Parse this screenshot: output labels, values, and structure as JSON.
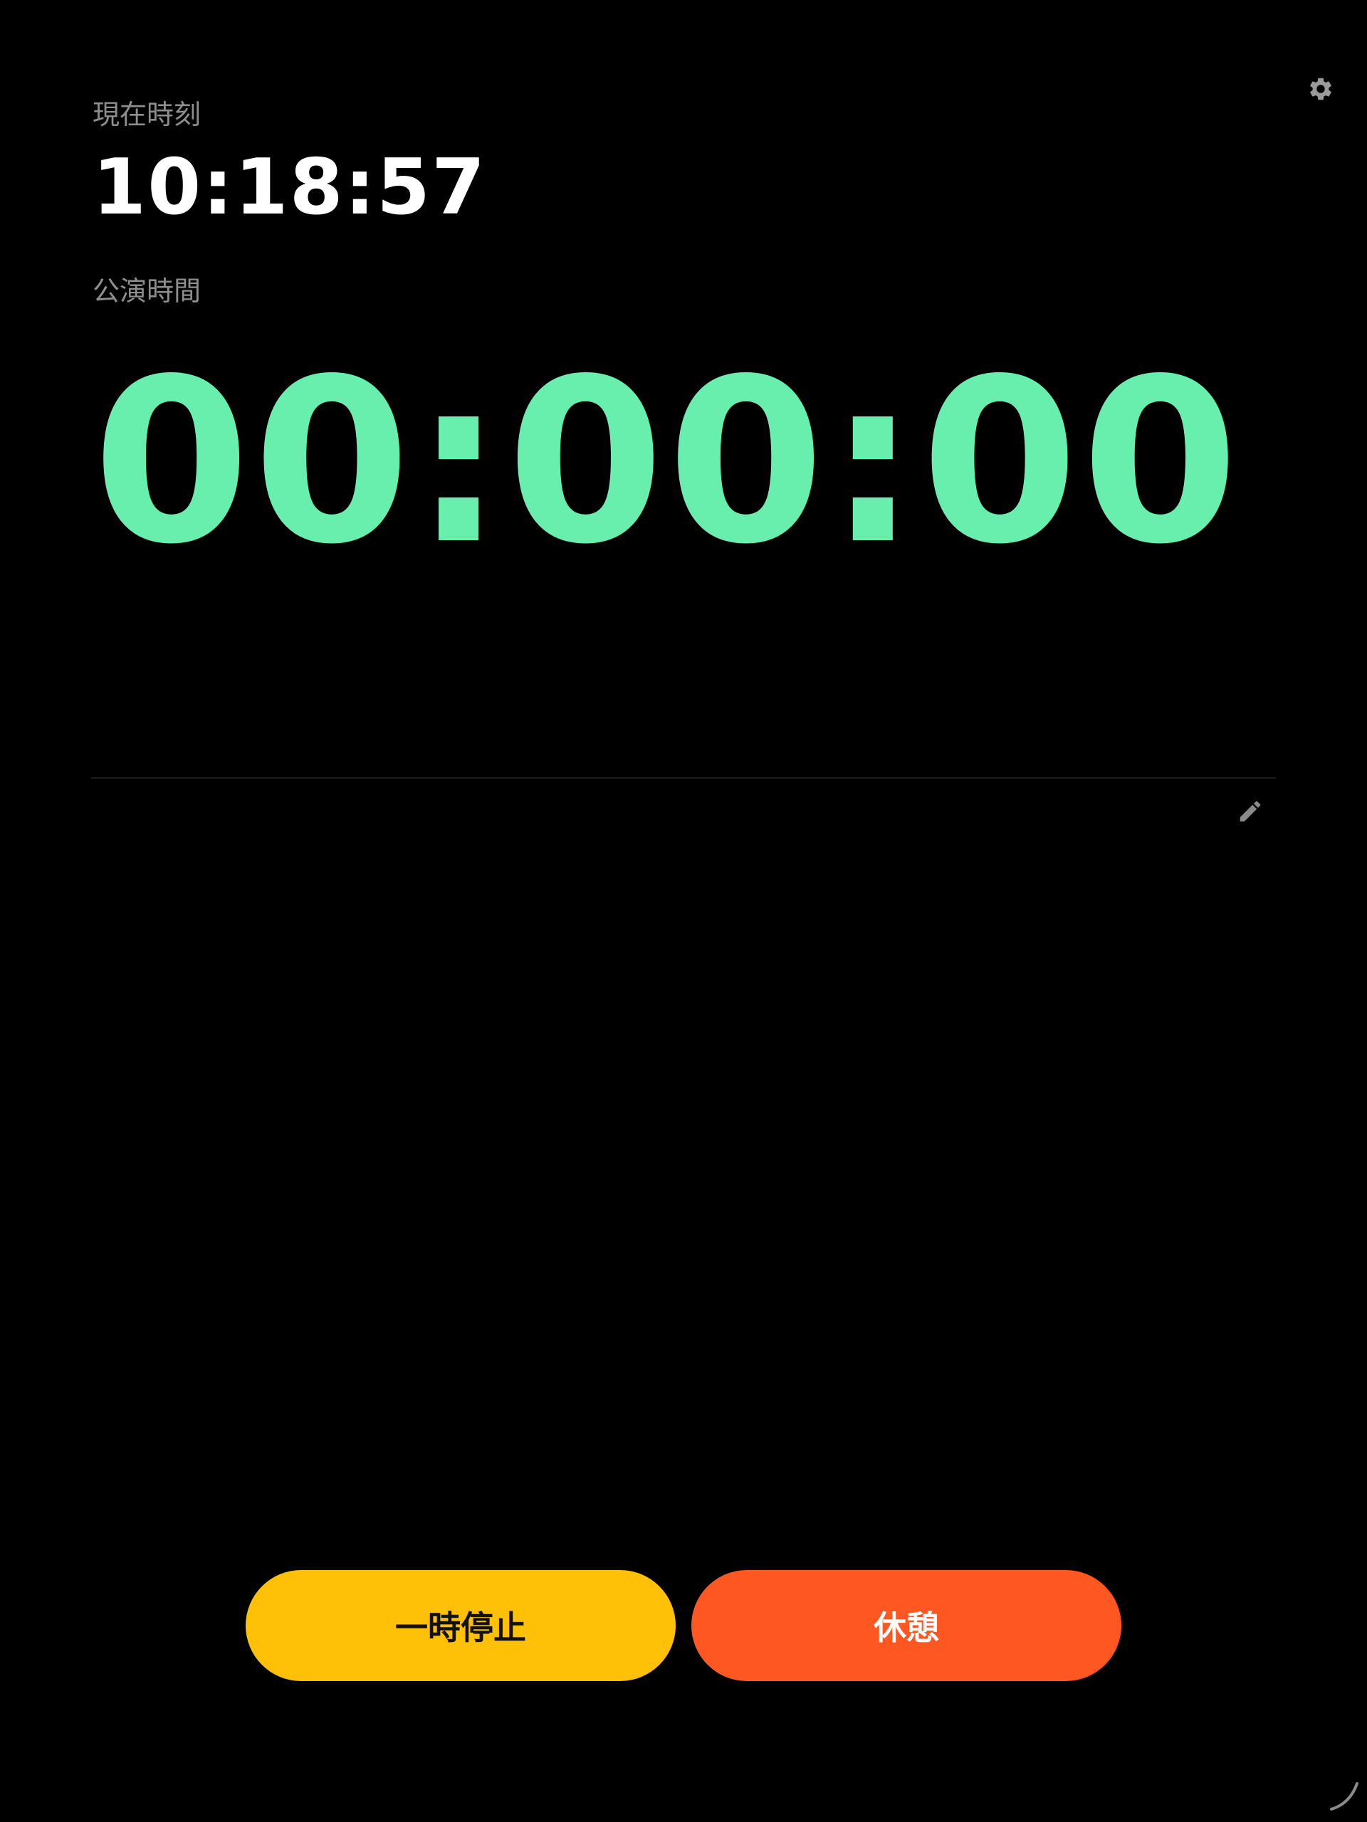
{
  "header": {
    "settings_icon": "gear-icon"
  },
  "clock": {
    "label": "現在時刻",
    "value": "10:18:57"
  },
  "performance": {
    "label": "公演時間",
    "value": "00:00:00",
    "color": "#69efad"
  },
  "notes": {
    "edit_icon": "pencil-icon"
  },
  "controls": {
    "pause_label": "一時停止",
    "pause_color": "#ffc107",
    "break_label": "休憩",
    "break_color": "#ff5722"
  },
  "corner": {
    "resize_icon": "resize-handle-icon"
  }
}
